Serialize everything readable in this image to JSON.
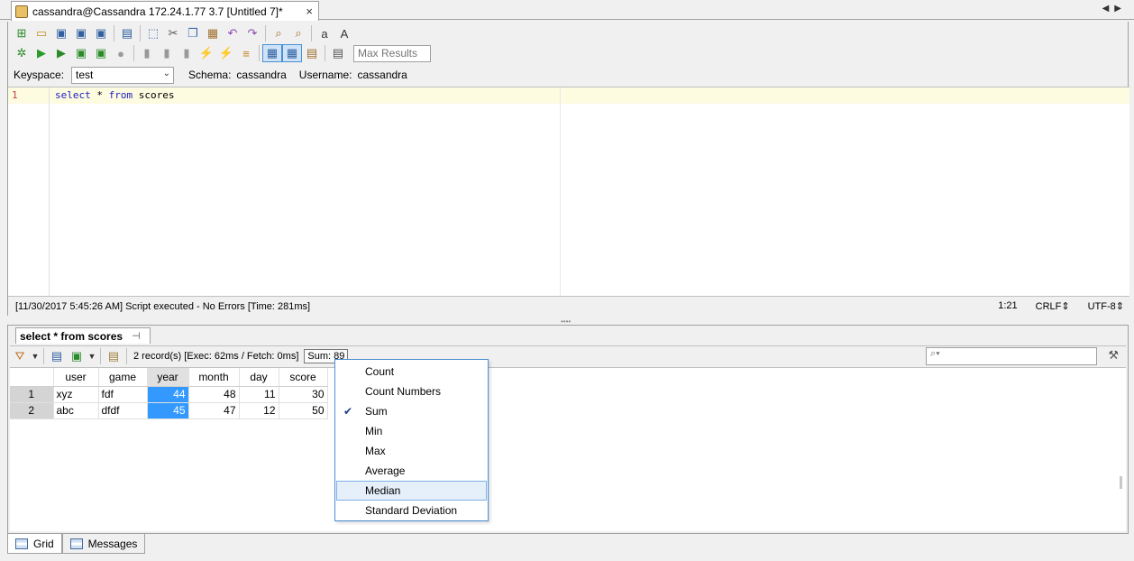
{
  "window": {
    "tab_title": "cassandra@Cassandra 172.24.1.77 3.7 [Untitled 7]*",
    "close_glyph": "×",
    "nav_left": "◀",
    "nav_right": "▶"
  },
  "toolbar": {
    "max_results_placeholder": "Max Results"
  },
  "connection": {
    "keyspace_label": "Keyspace:",
    "keyspace_value": "test",
    "schema_label": "Schema:",
    "schema_value": "cassandra",
    "username_label": "Username:",
    "username_value": "cassandra"
  },
  "editor": {
    "line_number": "1",
    "code_kw1": "select",
    "code_mid": " * ",
    "code_kw2": "from",
    "code_rest": " scores"
  },
  "status": {
    "message": "[11/30/2017 5:45:26 AM] Script executed - No Errors [Time: 281ms]",
    "position": "1:21",
    "line_ending": "CRLF",
    "encoding": "UTF-8"
  },
  "results": {
    "tab_label": "select * from scores",
    "record_info": "2 record(s) [Exec: 62ms / Fetch: 0ms]",
    "sum_label": "Sum: 89",
    "columns": [
      "user",
      "game",
      "year",
      "month",
      "day",
      "score"
    ],
    "rows": [
      {
        "rn": "1",
        "user": "xyz",
        "game": "fdf",
        "year": "44",
        "month": "48",
        "day": "11",
        "score": "30"
      },
      {
        "rn": "2",
        "user": "abc",
        "game": "dfdf",
        "year": "45",
        "month": "47",
        "day": "12",
        "score": "50"
      }
    ]
  },
  "aggregate_menu": {
    "items": [
      "Count",
      "Count Numbers",
      "Sum",
      "Min",
      "Max",
      "Average",
      "Median",
      "Standard Deviation"
    ],
    "checked": "Sum",
    "highlighted": "Median"
  },
  "bottom_tabs": {
    "grid_label": "Grid",
    "messages_label": "Messages"
  }
}
